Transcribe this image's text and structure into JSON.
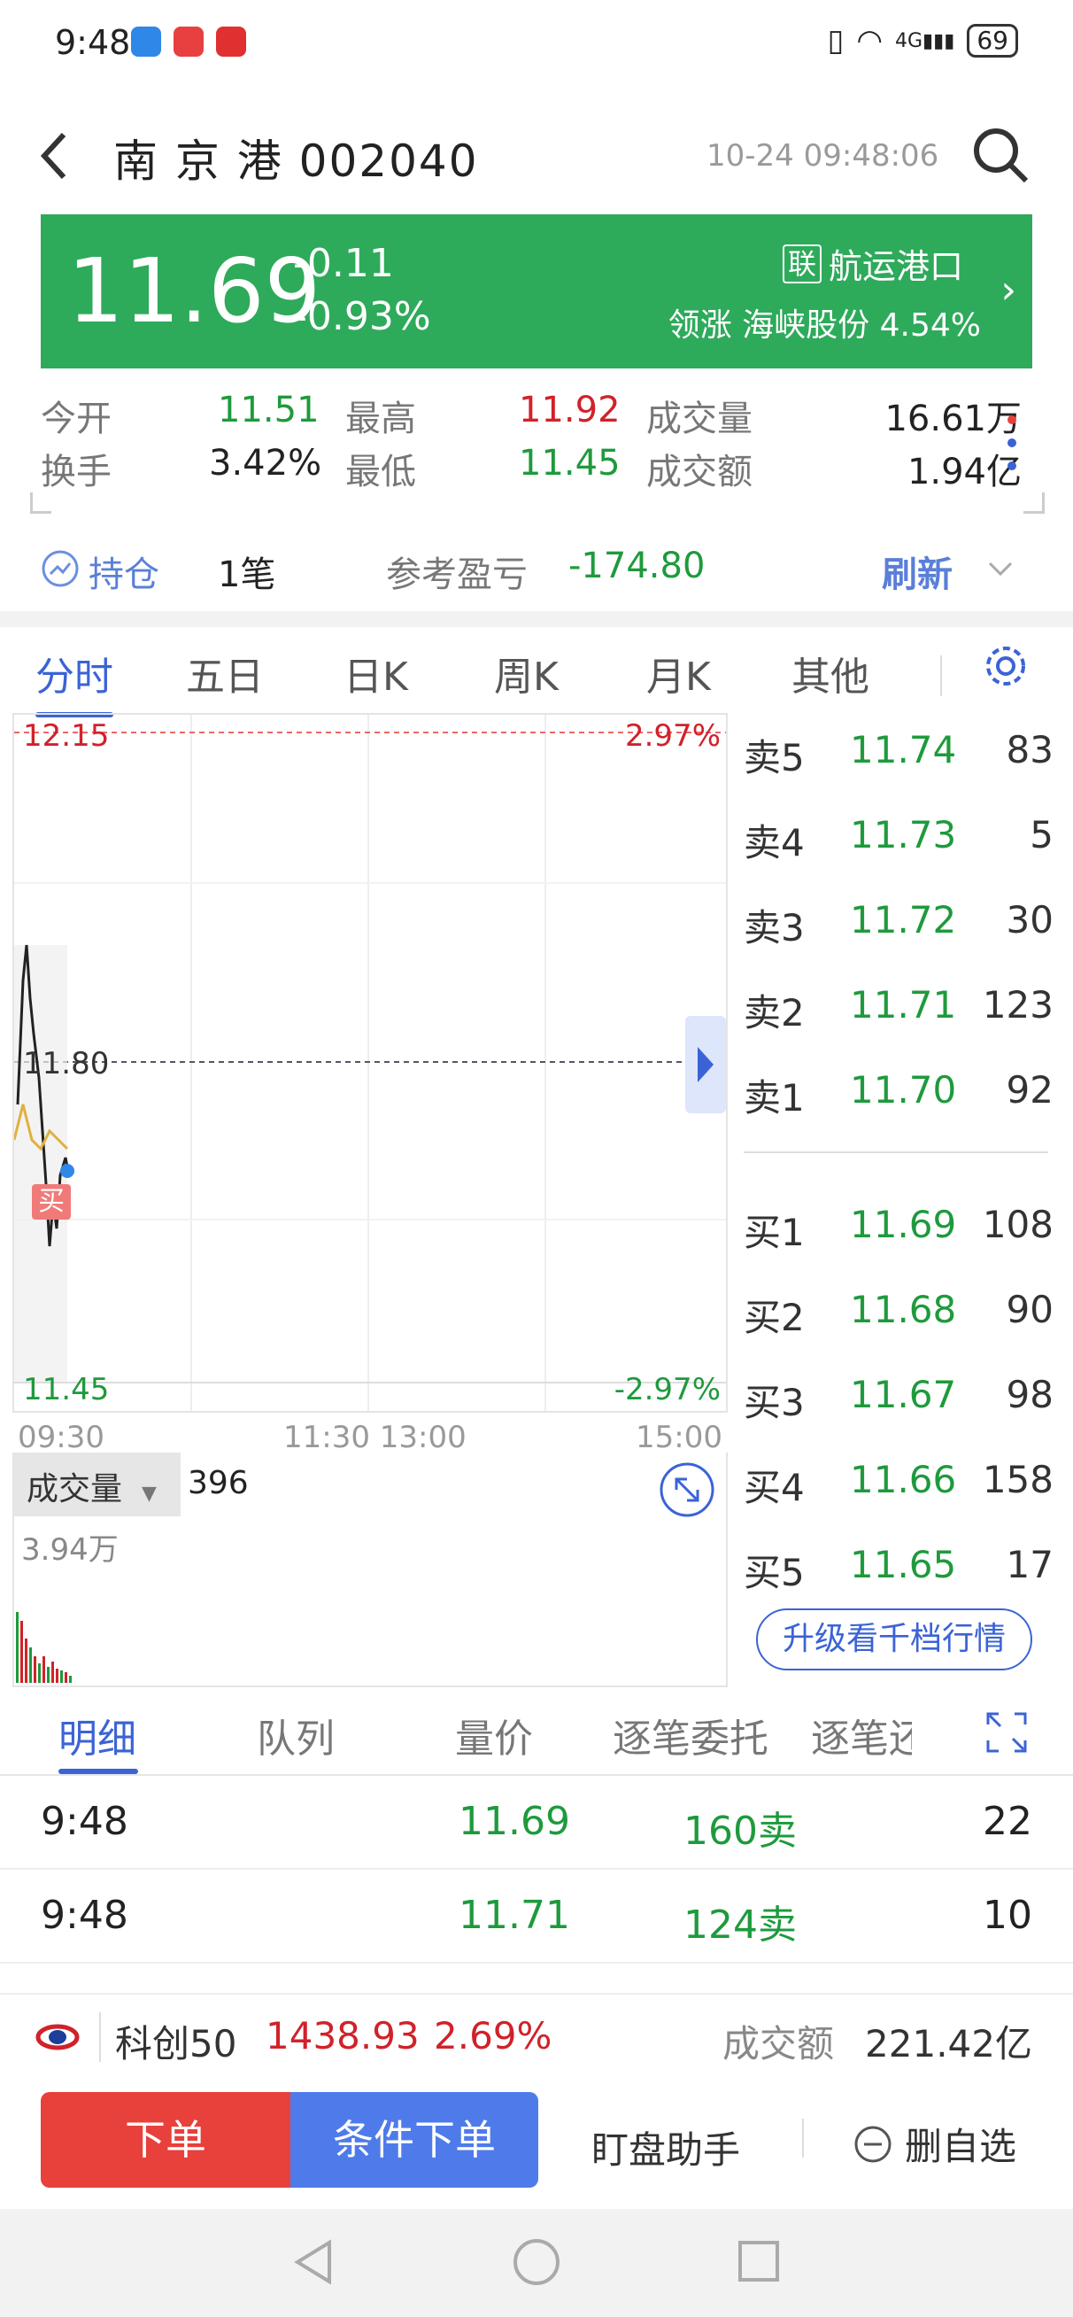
{
  "status_bar": {
    "time": "9:48",
    "battery": "69",
    "net": "4G"
  },
  "header": {
    "title": "南 京 港 002040",
    "timestamp": "10-24 09:48:06"
  },
  "quote": {
    "price": "11.69",
    "change": "-0.11",
    "change_pct": "-0.93%",
    "sector_badge": "联",
    "sector": "航运港口",
    "leader_label": "领涨",
    "leader_name": "海峡股份",
    "leader_pct": "4.54%"
  },
  "stats": {
    "open_label": "今开",
    "open": "11.51",
    "high_label": "最高",
    "high": "11.92",
    "volume_label": "成交量",
    "volume": "16.61万",
    "turnover_label": "换手",
    "turnover": "3.42%",
    "low_label": "最低",
    "low": "11.45",
    "amount_label": "成交额",
    "amount": "1.94亿"
  },
  "holding": {
    "label": "持仓",
    "count": "1笔",
    "pnl_label": "参考盈亏",
    "pnl": "-174.80",
    "refresh": "刷新"
  },
  "chart_tabs": [
    "分时",
    "五日",
    "日K",
    "周K",
    "月K",
    "其他"
  ],
  "chart": {
    "top_price": "12.15",
    "top_pct": "2.97%",
    "mid_price": "11.80",
    "bottom_price": "11.45",
    "bottom_pct": "-2.97%",
    "times": [
      "09:30",
      "11:30 13:00",
      "15:00"
    ],
    "buy_mark": "买"
  },
  "volume_panel": {
    "label": "成交量",
    "value": "396",
    "max": "3.94万"
  },
  "order_book": {
    "asks": [
      {
        "side": "卖5",
        "price": "11.74",
        "qty": "83"
      },
      {
        "side": "卖4",
        "price": "11.73",
        "qty": "5"
      },
      {
        "side": "卖3",
        "price": "11.72",
        "qty": "30"
      },
      {
        "side": "卖2",
        "price": "11.71",
        "qty": "123"
      },
      {
        "side": "卖1",
        "price": "11.70",
        "qty": "92"
      }
    ],
    "bids": [
      {
        "side": "买1",
        "price": "11.69",
        "qty": "108"
      },
      {
        "side": "买2",
        "price": "11.68",
        "qty": "90"
      },
      {
        "side": "买3",
        "price": "11.67",
        "qty": "98"
      },
      {
        "side": "买4",
        "price": "11.66",
        "qty": "158"
      },
      {
        "side": "买5",
        "price": "11.65",
        "qty": "17"
      }
    ],
    "upgrade": "升级看千档行情"
  },
  "sub_tabs": [
    "明细",
    "队列",
    "量价",
    "逐笔委托",
    "逐笔还原"
  ],
  "trades": [
    {
      "time": "9:48",
      "price": "11.69",
      "vol": "160卖",
      "count": "22"
    },
    {
      "time": "9:48",
      "price": "11.71",
      "vol": "124卖",
      "count": "10"
    }
  ],
  "index_bar": {
    "name": "科创50",
    "value": "1438.93",
    "pct": "2.69%",
    "amount_label": "成交额",
    "amount": "221.42亿"
  },
  "actions": {
    "order": "下单",
    "conditional": "条件下单",
    "assistant": "盯盘助手",
    "remove": "删自选"
  },
  "colors": {
    "green": "#2eaa5b",
    "red": "#e8403b",
    "blue": "#3b63d6",
    "down": "#1e9a3c",
    "up": "#d0222a"
  }
}
